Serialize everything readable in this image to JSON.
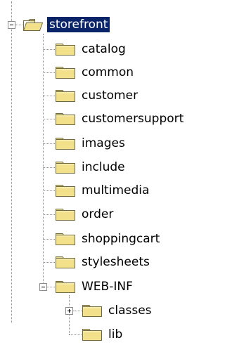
{
  "tree": {
    "root": {
      "label": "storefront",
      "expanded": true,
      "selected": true
    },
    "children": [
      {
        "label": "catalog"
      },
      {
        "label": "common"
      },
      {
        "label": "customer"
      },
      {
        "label": "customersupport"
      },
      {
        "label": "images"
      },
      {
        "label": "include"
      },
      {
        "label": "multimedia"
      },
      {
        "label": "order"
      },
      {
        "label": "shoppingcart"
      },
      {
        "label": "stylesheets"
      },
      {
        "label": "WEB-INF",
        "expanded": true,
        "children": [
          {
            "label": "classes",
            "expanded": false
          },
          {
            "label": "lib"
          }
        ]
      }
    ]
  },
  "colors": {
    "selection_bg": "#0a246a",
    "selection_text": "#ffffff",
    "folder_fill": "#f2e18a",
    "folder_outline": "#6f6a40",
    "tree_lines": "#8c8c8c"
  },
  "icons": {
    "folder": "folder-icon",
    "expanded": "minus-box-icon",
    "collapsed": "plus-box-icon"
  }
}
